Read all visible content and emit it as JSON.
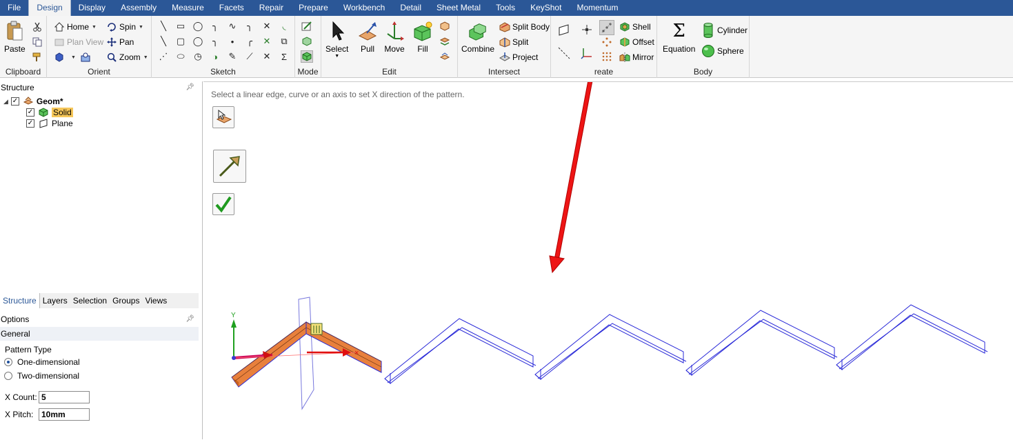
{
  "menu": {
    "items": [
      "File",
      "Design",
      "Display",
      "Assembly",
      "Measure",
      "Facets",
      "Repair",
      "Prepare",
      "Workbench",
      "Detail",
      "Sheet Metal",
      "Tools",
      "KeyShot",
      "Momentum"
    ],
    "active": "Design"
  },
  "ribbon": {
    "clipboard": {
      "label": "Clipboard",
      "paste": "Paste"
    },
    "orient": {
      "label": "Orient",
      "home": "Home",
      "plan_view": "Plan View",
      "spin": "Spin",
      "pan": "Pan",
      "zoom": "Zoom"
    },
    "sketch": {
      "label": "Sketch"
    },
    "mode": {
      "label": "Mode"
    },
    "edit": {
      "label": "Edit",
      "select": "Select",
      "pull": "Pull",
      "move": "Move",
      "fill": "Fill"
    },
    "intersect": {
      "label": "Intersect",
      "combine": "Combine",
      "split_body": "Split Body",
      "split": "Split",
      "project": "Project"
    },
    "create": {
      "label": "reate",
      "shell": "Shell",
      "offset": "Offset",
      "mirror": "Mirror"
    },
    "body": {
      "label": "Body",
      "equation": "Equation",
      "cylinder": "Cylinder",
      "sphere": "Sphere"
    }
  },
  "structure": {
    "title": "Structure",
    "root": "Geom*",
    "children": [
      "Solid",
      "Plane"
    ]
  },
  "bottom_tabs": [
    "Structure",
    "Layers",
    "Selection",
    "Groups",
    "Views"
  ],
  "options": {
    "title": "Options",
    "section": "General",
    "pattern_type_label": "Pattern Type",
    "one_dim": "One-dimensional",
    "two_dim": "Two-dimensional",
    "selected_pattern": "One-dimensional",
    "x_count_label": "X Count:",
    "x_count": "5",
    "x_pitch_label": "X Pitch:",
    "x_pitch": "10mm"
  },
  "viewport": {
    "hint": "Select a linear edge, curve or an axis to set X direction of the pattern.",
    "axis_y_label": "Y"
  },
  "colors": {
    "menubar": "#2b5797",
    "solid_fill": "#e8803c",
    "pattern_edges": "#2a2ad8",
    "annotation_arrow": "#e01010"
  },
  "icons": [
    "paste-icon",
    "cut-icon",
    "copy-icon",
    "format-painter-icon",
    "home-icon",
    "spin-icon",
    "pan-icon",
    "zoom-icon",
    "select-icon",
    "pull-icon",
    "move-icon",
    "fill-icon",
    "combine-icon",
    "shell-icon",
    "offset-icon",
    "mirror-icon",
    "equation-icon",
    "cylinder-icon",
    "sphere-icon",
    "check-icon",
    "direction-arrow-icon"
  ]
}
